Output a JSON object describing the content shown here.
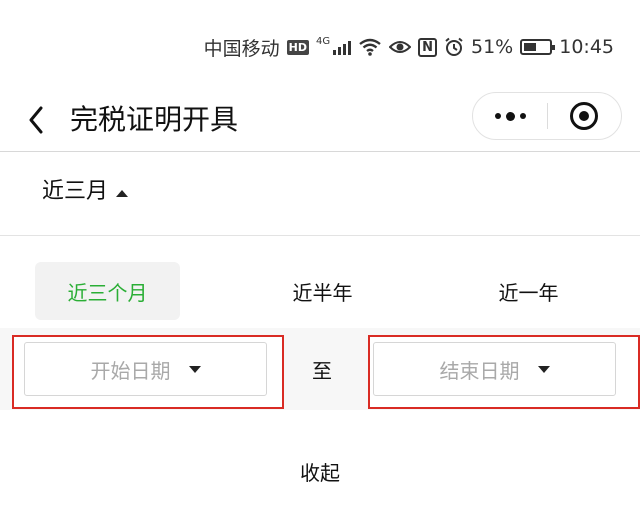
{
  "status_bar": {
    "carrier": "中国移动",
    "hd_badge": "HD",
    "network_type": "4G",
    "battery_percent": "51%",
    "battery_level": 0.51,
    "time": "10:45",
    "icons": [
      "hd-icon",
      "signal-icon",
      "wifi-icon",
      "eye-icon",
      "nfc-icon",
      "alarm-icon",
      "battery-icon"
    ]
  },
  "nav": {
    "title": "完税证明开具",
    "back_icon": "chevron-left-icon",
    "more_icon": "more-dots-icon",
    "close_icon": "target-close-icon"
  },
  "filter": {
    "current_label": "近三月",
    "options": [
      {
        "label": "近三个月",
        "selected": true
      },
      {
        "label": "近半年",
        "selected": false
      },
      {
        "label": "近一年",
        "selected": false
      }
    ],
    "start_date_placeholder": "开始日期",
    "to_label": "至",
    "end_date_placeholder": "结束日期",
    "collapse_label": "收起"
  },
  "colors": {
    "accent_green": "#2aae35",
    "highlight_red": "#d92b24",
    "selected_bg": "#f2f2f2"
  }
}
